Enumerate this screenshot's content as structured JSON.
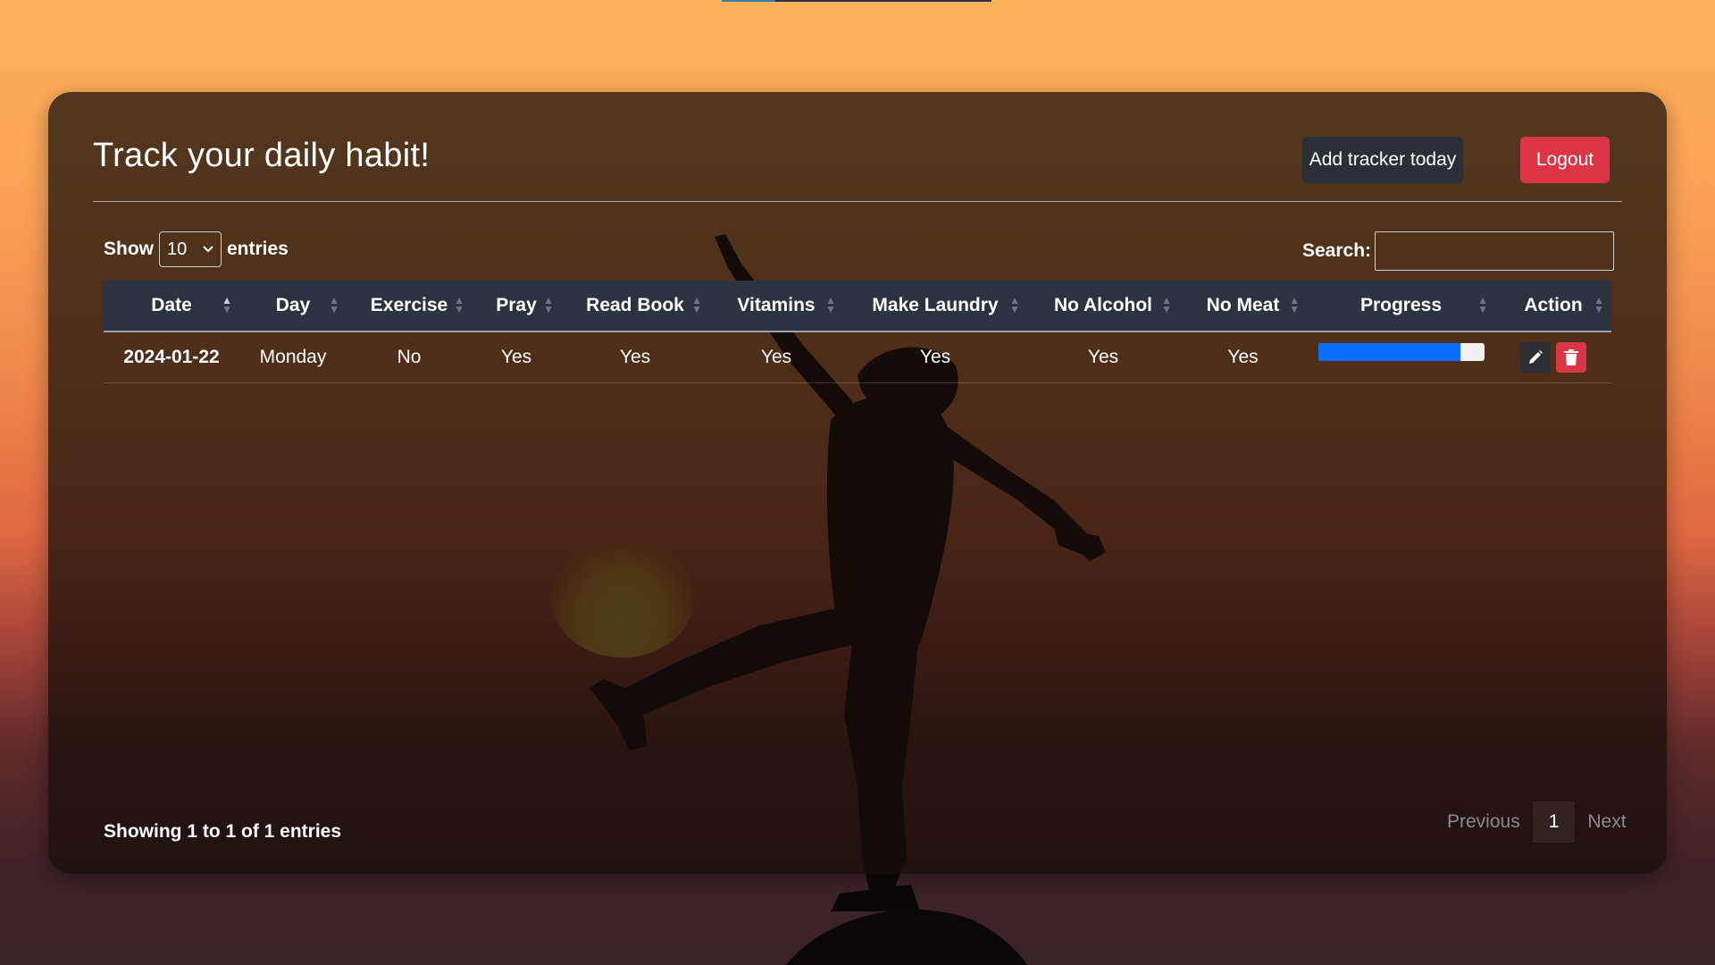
{
  "header": {
    "title": "Track your daily habit!",
    "add_button": "Add tracker today",
    "logout_button": "Logout"
  },
  "table_controls": {
    "show_label": "Show",
    "entries_value": "10",
    "entries_label": "entries",
    "search_label": "Search:",
    "search_value": ""
  },
  "table": {
    "columns": [
      "Date",
      "Day",
      "Exercise",
      "Pray",
      "Read Book",
      "Vitamins",
      "Make Laundry",
      "No Alcohol",
      "No Meat",
      "Progress",
      "Action"
    ],
    "rows": [
      {
        "date": "2024-01-22",
        "day": "Monday",
        "exercise": "No",
        "pray": "Yes",
        "read_book": "Yes",
        "vitamins": "Yes",
        "make_laundry": "Yes",
        "no_alcohol": "Yes",
        "no_meat": "Yes",
        "progress_percent": 86
      }
    ]
  },
  "footer": {
    "info": "Showing 1 to 1 of 1 entries",
    "prev": "Previous",
    "page": "1",
    "next": "Next"
  },
  "icons": {
    "edit": "pencil-icon",
    "delete": "trash-icon",
    "sort": "sort-icon"
  },
  "colors": {
    "danger": "#dc3545",
    "progress": "#0d6efd",
    "dark_button": "#2b3036"
  }
}
